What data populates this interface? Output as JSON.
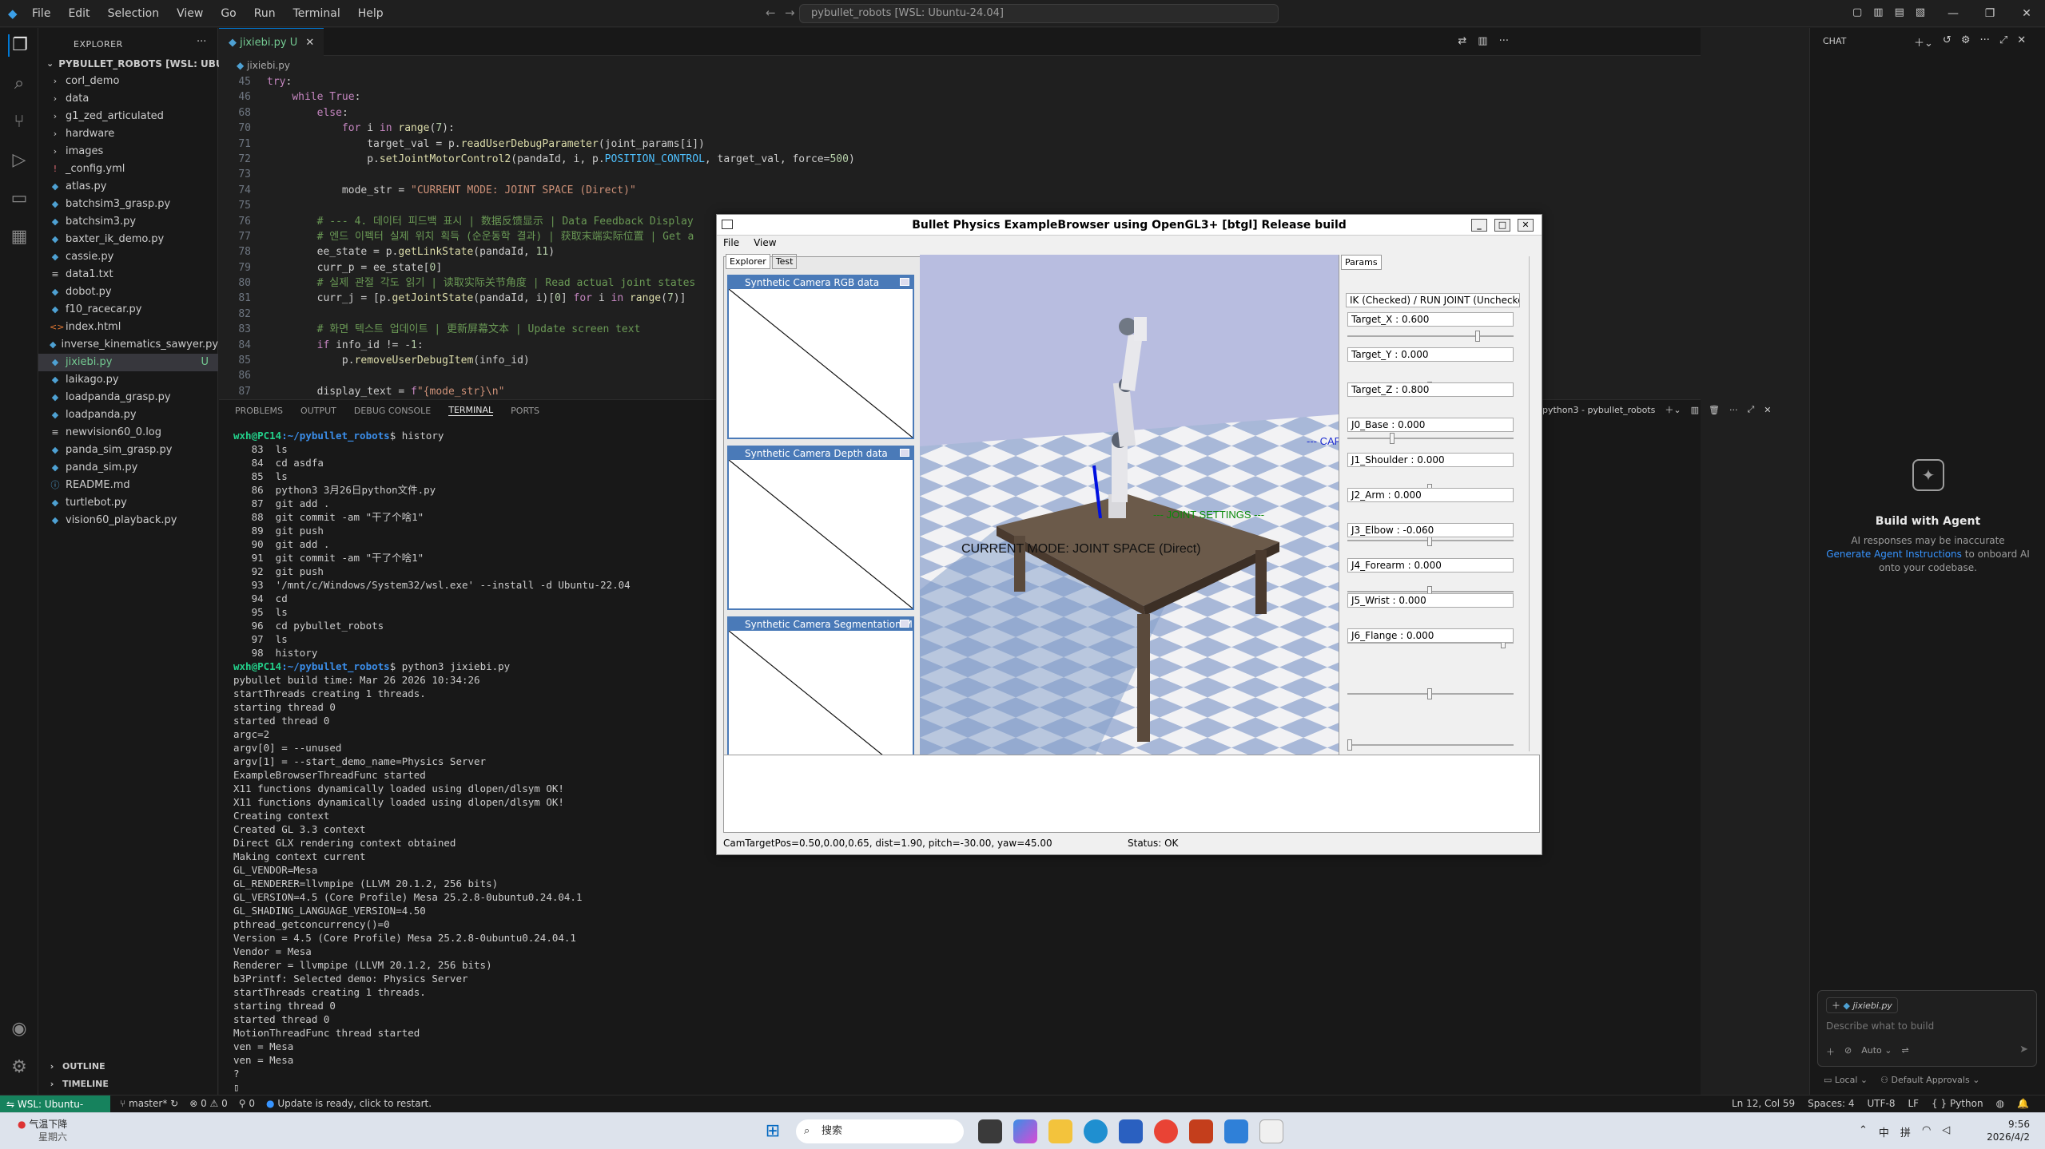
{
  "menu": [
    "File",
    "Edit",
    "Selection",
    "View",
    "Go",
    "Run",
    "Terminal",
    "Help"
  ],
  "command_center": "pybullet_robots [WSL: Ubuntu-24.04]",
  "explorer": {
    "header": "EXPLORER",
    "root": "PYBULLET_ROBOTS [WSL: UBUNTU-2...",
    "items": [
      {
        "name": "corl_demo",
        "type": "folder"
      },
      {
        "name": "data",
        "type": "folder"
      },
      {
        "name": "g1_zed_articulated",
        "type": "folder"
      },
      {
        "name": "hardware",
        "type": "folder"
      },
      {
        "name": "images",
        "type": "folder"
      },
      {
        "name": "_config.yml",
        "type": "yml"
      },
      {
        "name": "atlas.py",
        "type": "py"
      },
      {
        "name": "batchsim3_grasp.py",
        "type": "py"
      },
      {
        "name": "batchsim3.py",
        "type": "py"
      },
      {
        "name": "baxter_ik_demo.py",
        "type": "py"
      },
      {
        "name": "cassie.py",
        "type": "py"
      },
      {
        "name": "data1.txt",
        "type": "txt"
      },
      {
        "name": "dobot.py",
        "type": "py"
      },
      {
        "name": "f10_racecar.py",
        "type": "py"
      },
      {
        "name": "index.html",
        "type": "html"
      },
      {
        "name": "inverse_kinematics_sawyer.py",
        "type": "py"
      },
      {
        "name": "jixiebi.py",
        "type": "py",
        "badge": "U",
        "selected": true
      },
      {
        "name": "laikago.py",
        "type": "py"
      },
      {
        "name": "loadpanda_grasp.py",
        "type": "py"
      },
      {
        "name": "loadpanda.py",
        "type": "py"
      },
      {
        "name": "newvision60_0.log",
        "type": "log"
      },
      {
        "name": "panda_sim_grasp.py",
        "type": "py"
      },
      {
        "name": "panda_sim.py",
        "type": "py"
      },
      {
        "name": "README.md",
        "type": "md"
      },
      {
        "name": "turtlebot.py",
        "type": "py"
      },
      {
        "name": "vision60_playback.py",
        "type": "py"
      }
    ],
    "outline": "OUTLINE",
    "timeline": "TIMELINE"
  },
  "editor": {
    "tab": "jixiebi.py",
    "tab_badge": "U",
    "breadcrumb": "jixiebi.py",
    "lines": [
      {
        "n": "45",
        "t": "try:"
      },
      {
        "n": "46",
        "t": "    while True:"
      },
      {
        "n": "68",
        "t": "        else:"
      },
      {
        "n": "70",
        "t": "            for i in range(7):"
      },
      {
        "n": "71",
        "t": "                target_val = p.readUserDebugParameter(joint_params[i])"
      },
      {
        "n": "72",
        "t": "                p.setJointMotorControl2(pandaId, i, p.POSITION_CONTROL, target_val, force=500)"
      },
      {
        "n": "73",
        "t": ""
      },
      {
        "n": "74",
        "t": "            mode_str = \"CURRENT MODE: JOINT SPACE (Direct)\""
      },
      {
        "n": "75",
        "t": ""
      },
      {
        "n": "76",
        "t": "        # --- 4. 데이터 피드백 표시 | 数据反馈显示 | Data Feedback Display"
      },
      {
        "n": "77",
        "t": "        # 엔드 이펙터 실제 위치 획득 (순운동학 결과) | 获取末端实际位置 | Get a"
      },
      {
        "n": "78",
        "t": "        ee_state = p.getLinkState(pandaId, 11)"
      },
      {
        "n": "79",
        "t": "        curr_p = ee_state[0]"
      },
      {
        "n": "80",
        "t": "        # 실제 관절 각도 읽기 | 读取实际关节角度 | Read actual joint states"
      },
      {
        "n": "81",
        "t": "        curr_j = [p.getJointState(pandaId, i)[0] for i in range(7)]"
      },
      {
        "n": "82",
        "t": ""
      },
      {
        "n": "83",
        "t": "        # 화면 텍스트 업데이트 | 更新屏幕文本 | Update screen text"
      },
      {
        "n": "84",
        "t": "        if info_id != -1:"
      },
      {
        "n": "85",
        "t": "            p.removeUserDebugItem(info_id)"
      },
      {
        "n": "86",
        "t": ""
      },
      {
        "n": "87",
        "t": "        display_text = f\"{mode_str}\\n\""
      }
    ]
  },
  "panel": {
    "tabs": [
      "PROBLEMS",
      "OUTPUT",
      "DEBUG CONSOLE",
      "TERMINAL",
      "PORTS"
    ],
    "active_tab": "TERMINAL",
    "terminal_title": "python3 - pybullet_robots",
    "prompt_user": "wxh@PC14",
    "prompt_path": ":~/pybullet_robots",
    "history_cmd": "$ history",
    "history": [
      "   83  ls",
      "   84  cd asdfa",
      "   85  ls",
      "   86  python3 3月26日python文件.py",
      "   87  git add .",
      "   88  git commit -am \"干了个啥1\"",
      "   89  git push",
      "   90  git add .",
      "   91  git commit -am \"干了个啥1\"",
      "   92  git push",
      "   93  '/mnt/c/Windows/System32/wsl.exe' --install -d Ubuntu-22.04",
      "   94  cd",
      "   95  ls",
      "   96  cd pybullet_robots",
      "   97  ls",
      "   98  history"
    ],
    "run_cmd": "$ python3 jixiebi.py",
    "output": [
      "pybullet build time: Mar 26 2026 10:34:26",
      "startThreads creating 1 threads.",
      "starting thread 0",
      "started thread 0",
      "argc=2",
      "argv[0] = --unused",
      "argv[1] = --start_demo_name=Physics Server",
      "ExampleBrowserThreadFunc started",
      "X11 functions dynamically loaded using dlopen/dlsym OK!",
      "X11 functions dynamically loaded using dlopen/dlsym OK!",
      "Creating context",
      "Created GL 3.3 context",
      "Direct GLX rendering context obtained",
      "Making context current",
      "GL_VENDOR=Mesa",
      "GL_RENDERER=llvmpipe (LLVM 20.1.2, 256 bits)",
      "GL_VERSION=4.5 (Core Profile) Mesa 25.2.8-0ubuntu0.24.04.1",
      "GL_SHADING_LANGUAGE_VERSION=4.50",
      "pthread_getconcurrency()=0",
      "Version = 4.5 (Core Profile) Mesa 25.2.8-0ubuntu0.24.04.1",
      "Vendor = Mesa",
      "Renderer = llvmpipe (LLVM 20.1.2, 256 bits)",
      "b3Printf: Selected demo: Physics Server",
      "startThreads creating 1 threads.",
      "starting thread 0",
      "started thread 0",
      "MotionThreadFunc thread started",
      "ven = Mesa",
      "ven = Mesa",
      "?"
    ]
  },
  "chat": {
    "header": "CHAT",
    "title": "Build with Agent",
    "desc_1": "AI responses may be inaccurate",
    "desc_link": "Generate Agent Instructions",
    "desc_2": "to onboard AI onto your codebase.",
    "context_file": "jixiebi.py",
    "placeholder": "Describe what to build",
    "mode": "Auto",
    "location": "Local",
    "approvals": "Default Approvals"
  },
  "statusbar": {
    "remote": "WSL: Ubuntu-24.04",
    "branch": "master*",
    "errors": "0",
    "warnings": "0",
    "ports": "0",
    "update": "Update is ready, click to restart.",
    "position": "Ln 12, Col 59",
    "spaces": "Spaces: 4",
    "encoding": "UTF-8",
    "eol": "LF",
    "language": "Python"
  },
  "bullet": {
    "title": "Bullet Physics ExampleBrowser using OpenGL3+ [btgl] Release build",
    "menu": [
      "File",
      "View"
    ],
    "left_tabs": [
      "Explorer",
      "Test"
    ],
    "cameras": [
      "Synthetic Camera RGB data",
      "Synthetic Camera Depth data",
      "Synthetic Camera Segmentation Mask"
    ],
    "mode_text": "CURRENT MODE: JOINT SPACE (Direct)",
    "joint_settings": "--- JOINT SETTINGS ---",
    "car_text": "--- CAR",
    "params_tab": "Params",
    "ik_toggle": "IK (Checked) / RUN JOINT (Unchecked)",
    "params": [
      {
        "label": "Target_X : 0.600",
        "value": 0.6,
        "min": -1,
        "max": 1
      },
      {
        "label": "Target_Y : 0.000",
        "value": 0.0,
        "min": -1,
        "max": 1
      },
      {
        "label": "Target_Z : 0.800",
        "value": 0.8,
        "min": 0,
        "max": 3
      },
      {
        "label": "J0_Base : 0.000",
        "value": 0.0,
        "min": -1,
        "max": 1
      },
      {
        "label": "J1_Shoulder : 0.000",
        "value": 0.0,
        "min": -1,
        "max": 1
      },
      {
        "label": "J2_Arm : 0.000",
        "value": 0.0,
        "min": -1,
        "max": 1
      },
      {
        "label": "J3_Elbow : -0.060",
        "value": 0.96,
        "min": 0,
        "max": 1
      },
      {
        "label": "J4_Forearm : 0.000",
        "value": 0.0,
        "min": -1,
        "max": 1
      },
      {
        "label": "J5_Wrist : 0.000",
        "value": 0.0,
        "min": 0,
        "max": 1
      },
      {
        "label": "J6_Flange : 0.000",
        "value": 0.0,
        "min": -1,
        "max": 1
      }
    ],
    "status_left": "CamTargetPos=0.50,0.00,0.65, dist=1.90, pitch=-30.00, yaw=45.00",
    "status_right": "Status: OK"
  },
  "taskbar": {
    "weather_title": "气温下降",
    "weather_sub": "星期六",
    "search": "搜索",
    "time": "9:56",
    "date": "2026/4/2",
    "ime": "中",
    "ime2": "拼"
  }
}
